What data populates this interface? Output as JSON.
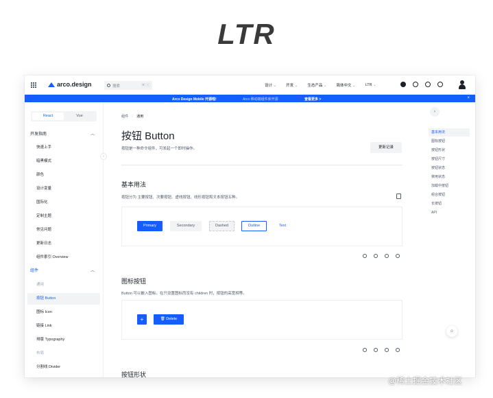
{
  "heading": "LTR",
  "nav": {
    "logo": "arco.design",
    "search_placeholder": "搜索",
    "menu": [
      "设计",
      "开发",
      "生态产品",
      "简体中文",
      "LTR"
    ]
  },
  "banner": {
    "main": "Arco Design Mobile 开源啦!",
    "sub": "Arco 移动端组件库开源",
    "link": "查看更多 >",
    "close": "×"
  },
  "sidebar": {
    "framework_tabs": [
      "React",
      "Vue"
    ],
    "active_tab": "React",
    "groups": [
      {
        "title": "开发指南",
        "items": [
          "快速上手",
          "暗黑模式",
          "颜色",
          "设计变量",
          "国际化",
          "定制主题",
          "常见问题",
          "更新日志",
          "组件索引 Overview"
        ]
      },
      {
        "title": "组件",
        "items": [
          "通用",
          "按钮 Button",
          "图标 Icon",
          "链接 Link",
          "排版 Typography",
          "布局",
          "分割线 Divider"
        ]
      }
    ]
  },
  "content": {
    "breadcrumb": [
      "组件",
      "通用"
    ],
    "title": "按钮 Button",
    "description": "按钮是一种命令组件，可发起一个即时操作。",
    "changelog_button": "更新记录",
    "sections": [
      {
        "title": "基本用法",
        "description": "按钮分为 主要按钮、次要按钮、虚线按钮、线形按钮和文本按钮五种。",
        "buttons": [
          "Primary",
          "Secondary",
          "Dashed",
          "Outline",
          "Text"
        ]
      },
      {
        "title": "图标按钮",
        "description": "Button 可以嵌入图标。在只设置图标而没有 children 时，按钮的高宽相等。",
        "buttons": [
          "+",
          "Delete"
        ]
      },
      {
        "title": "按钮形状"
      }
    ]
  },
  "toc": {
    "items": [
      "基本用法",
      "图标按钮",
      "按钮形状",
      "按钮尺寸",
      "按钮状态",
      "禁用状态",
      "加载中按钮",
      "组合按钮",
      "长按钮",
      "API"
    ],
    "active": "基本用法"
  },
  "watermark": "@稀土掘金技术社区",
  "colors": {
    "primary": "#165dff",
    "banner": "#165dff",
    "text": "#1d2129",
    "muted": "#86909c"
  }
}
